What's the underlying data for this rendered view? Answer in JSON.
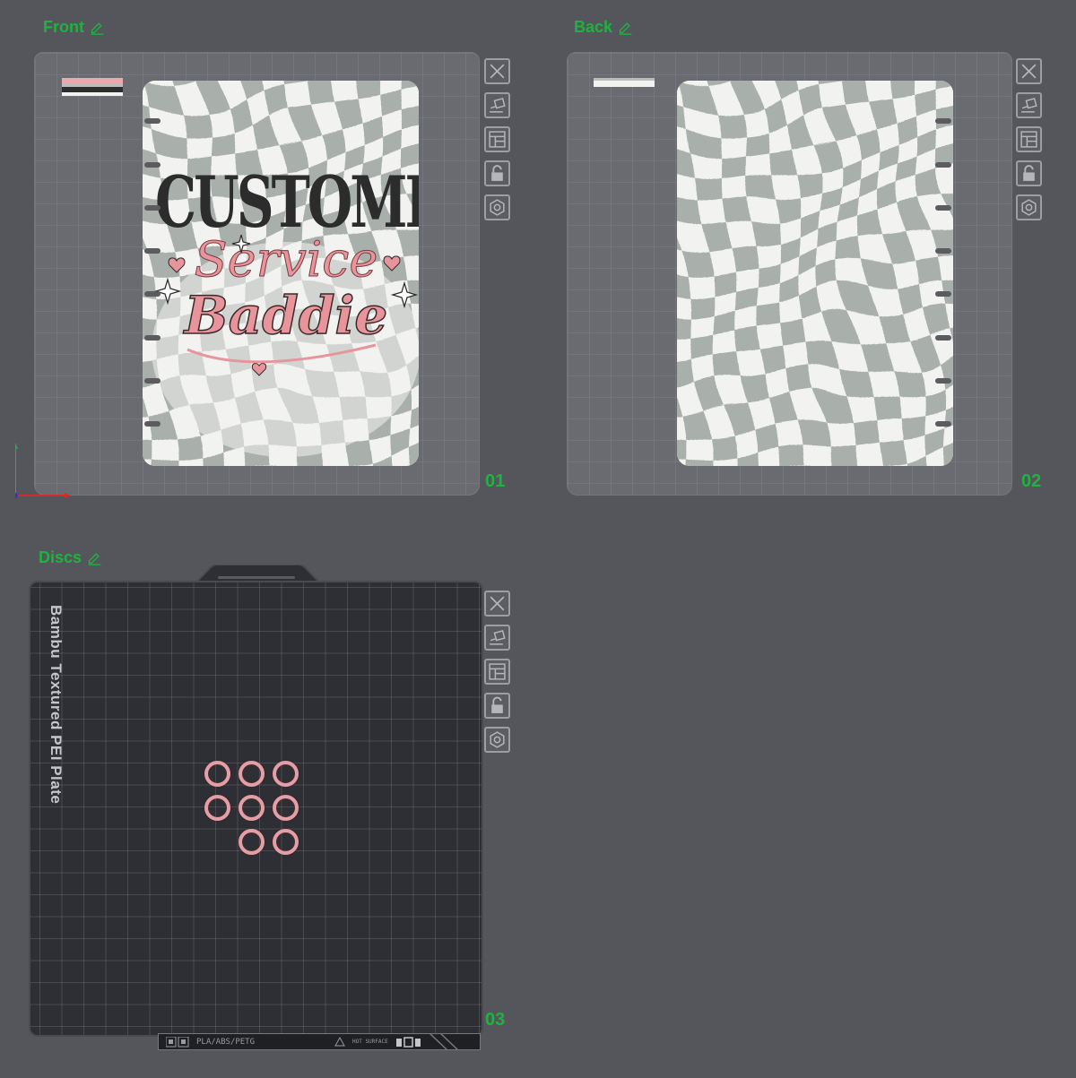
{
  "plates": [
    {
      "id": "front",
      "title": "Front",
      "number": "01"
    },
    {
      "id": "back",
      "title": "Back",
      "number": "02"
    },
    {
      "id": "discs",
      "title": "Discs",
      "number": "03"
    }
  ],
  "front_cover": {
    "line1": "CUSTOMER",
    "line2": "Service",
    "line3": "Baddie"
  },
  "discs_plate": {
    "plate_name": "Bambu Textured PEI Plate",
    "filament_text": "PLA/ABS/PETG",
    "surface_text": "HOT SURFACE",
    "disc_count": 8
  },
  "toolbar_icons": [
    "close-icon",
    "auto-arrange-icon",
    "layout-icon",
    "lock-icon",
    "settings-hex-icon"
  ],
  "colors": {
    "background": "#55565b",
    "accent_green": "#1fb241",
    "checker_gray": "#a9b0ab",
    "pink": "#e8949b",
    "dark_text": "#2c2c2c"
  }
}
